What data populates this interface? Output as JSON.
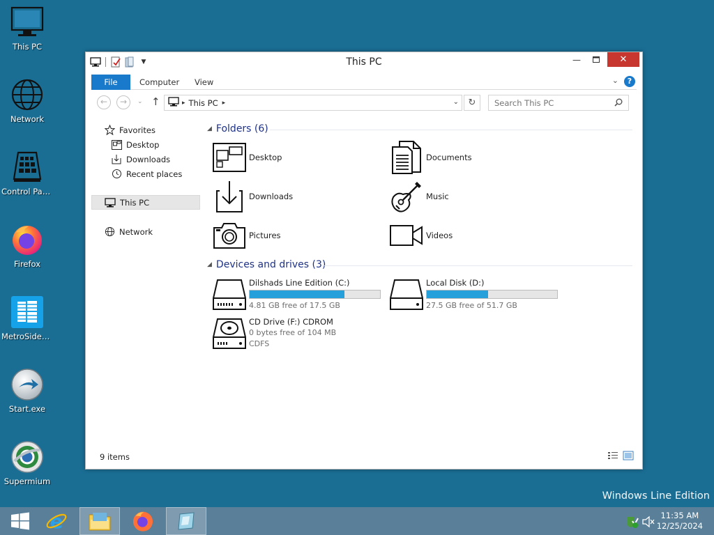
{
  "desktop": {
    "icons": [
      {
        "label": "This PC",
        "icon": "monitor-icon"
      },
      {
        "label": "Network",
        "icon": "globe-icon"
      },
      {
        "label": "Control Panel",
        "icon": "control-panel-icon"
      },
      {
        "label": "Firefox",
        "icon": "firefox-icon"
      },
      {
        "label": "MetroSideb...",
        "icon": "windows-tiles-icon"
      },
      {
        "label": "Start.exe",
        "icon": "start-exe-icon"
      },
      {
        "label": "Supermium",
        "icon": "supermium-icon"
      }
    ],
    "watermark": "Windows Line Edition"
  },
  "window": {
    "title": "This PC",
    "ribbon_tabs": {
      "file": "File",
      "computer": "Computer",
      "view": "View"
    },
    "address": {
      "crumb": "This PC"
    },
    "search": {
      "placeholder": "Search This PC"
    },
    "nav_pane": {
      "favorites": "Favorites",
      "desktop": "Desktop",
      "downloads": "Downloads",
      "recent": "Recent places",
      "this_pc": "This PC",
      "network": "Network"
    },
    "folders": {
      "header": "Folders (6)",
      "items": {
        "desktop": "Desktop",
        "documents": "Documents",
        "downloads": "Downloads",
        "music": "Music",
        "pictures": "Pictures",
        "videos": "Videos"
      }
    },
    "devices": {
      "header": "Devices and drives (3)",
      "c": {
        "name": "Dilshads Line Edition (C:)",
        "free": "4.81 GB free of 17.5 GB",
        "used_fraction": 0.725
      },
      "d": {
        "name": "Local Disk (D:)",
        "free": "27.5 GB free of 51.7 GB",
        "used_fraction": 0.468
      },
      "f": {
        "name": "CD Drive (F:) CDROM",
        "free": "0 bytes free of 104 MB",
        "fs": "CDFS"
      }
    },
    "status": "9 items"
  },
  "taskbar": {
    "time": "11:35 AM",
    "date": "12/25/2024"
  },
  "colors": {
    "desktop_bg": "#1a6e94",
    "accent": "#1979ca",
    "drive_bar": "#26a0da",
    "close_button": "#c7372f"
  }
}
